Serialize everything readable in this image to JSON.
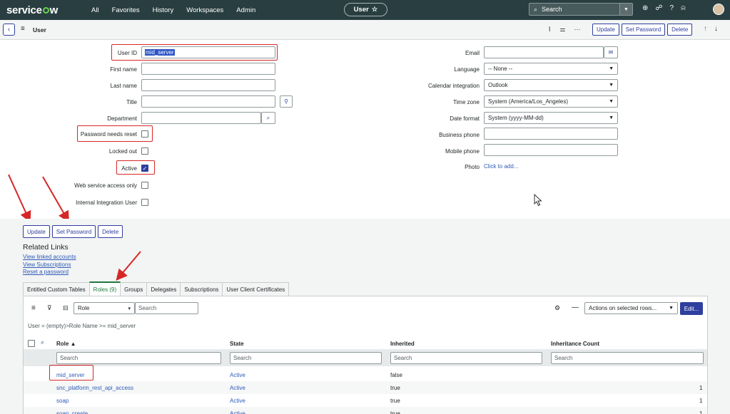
{
  "nav": {
    "logo": "servicenow",
    "menu": [
      "All",
      "Favorites",
      "History",
      "Workspaces",
      "Admin"
    ],
    "record_pill": "User",
    "search_placeholder": "Search"
  },
  "header": {
    "title": "User",
    "buttons": [
      "Update",
      "Set Password",
      "Delete"
    ]
  },
  "form": {
    "left": {
      "user_id_label": "User ID",
      "user_id_value": "mid_server",
      "first_name_label": "First name",
      "last_name_label": "Last name",
      "title_label": "Title",
      "department_label": "Department",
      "password_reset_label": "Password needs reset",
      "locked_out_label": "Locked out",
      "active_label": "Active",
      "web_service_label": "Web service access only",
      "internal_integration_label": "Internal Integration User"
    },
    "right": {
      "email_label": "Email",
      "language_label": "Language",
      "language_value": "-- None --",
      "calendar_label": "Calendar integration",
      "calendar_value": "Outlook",
      "timezone_label": "Time zone",
      "timezone_value": "System (America/Los_Angeles)",
      "date_format_label": "Date format",
      "date_format_value": "System (yyyy-MM-dd)",
      "business_phone_label": "Business phone",
      "mobile_phone_label": "Mobile phone",
      "photo_label": "Photo",
      "photo_link": "Click to add..."
    },
    "checkboxes": {
      "password_reset": false,
      "locked_out": false,
      "active": true,
      "web_service": false,
      "internal_integration": false
    }
  },
  "bottom_buttons": [
    "Update",
    "Set Password",
    "Delete"
  ],
  "related": {
    "title": "Related Links",
    "links": [
      "View linked accounts",
      "View Subscriptions",
      "Reset a password"
    ]
  },
  "tabs": [
    "Entitled Custom Tables",
    "Roles (9)",
    "Groups",
    "Delegates",
    "Subscriptions",
    "User Client Certificates"
  ],
  "list": {
    "filter_field": "Role",
    "search_placeholder": "Search",
    "actions_label": "Actions on selected rows...",
    "edit_label": "Edit...",
    "breadcrumb": "User = (empty)>Role Name >= mid_server",
    "columns": [
      "Role",
      "State",
      "Inherited",
      "Inheritance Count"
    ],
    "rows": [
      {
        "role": "mid_server",
        "state": "Active",
        "inherited": "false",
        "count": ""
      },
      {
        "role": "snc_platform_rest_api_access",
        "state": "Active",
        "inherited": "true",
        "count": "1"
      },
      {
        "role": "soap",
        "state": "Active",
        "inherited": "true",
        "count": "1"
      },
      {
        "role": "soap_create",
        "state": "Active",
        "inherited": "true",
        "count": "1"
      }
    ]
  },
  "colors": {
    "nav_bg": "#293e40",
    "accent": "#2e3f9e",
    "annotation_red": "#d62727",
    "active_tab": "#1f7a3c"
  }
}
